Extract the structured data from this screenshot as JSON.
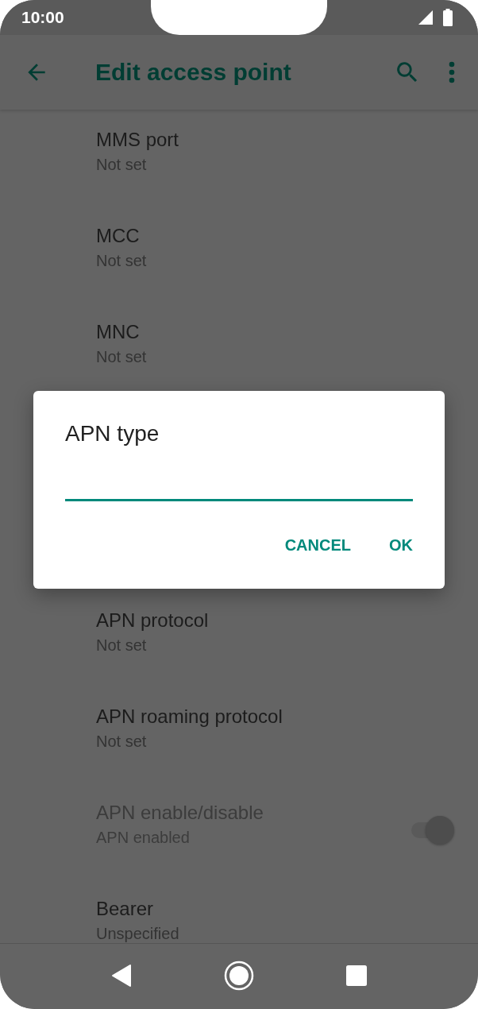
{
  "status_bar": {
    "time": "10:00"
  },
  "app_bar": {
    "title": "Edit access point"
  },
  "settings": [
    {
      "title": "MMS port",
      "summary": "Not set",
      "disabled": false
    },
    {
      "title": "MCC",
      "summary": "Not set",
      "disabled": false
    },
    {
      "title": "MNC",
      "summary": "Not set",
      "disabled": false
    },
    {
      "title": "APN protocol",
      "summary": "Not set",
      "disabled": false
    },
    {
      "title": "APN roaming protocol",
      "summary": "Not set",
      "disabled": false
    },
    {
      "title": "APN enable/disable",
      "summary": "APN enabled",
      "disabled": true,
      "kind": "switch",
      "on": true
    },
    {
      "title": "Bearer",
      "summary": "Unspecified",
      "disabled": false
    }
  ],
  "dialog": {
    "title": "APN type",
    "buttons": [
      "CANCEL",
      "OK"
    ]
  }
}
